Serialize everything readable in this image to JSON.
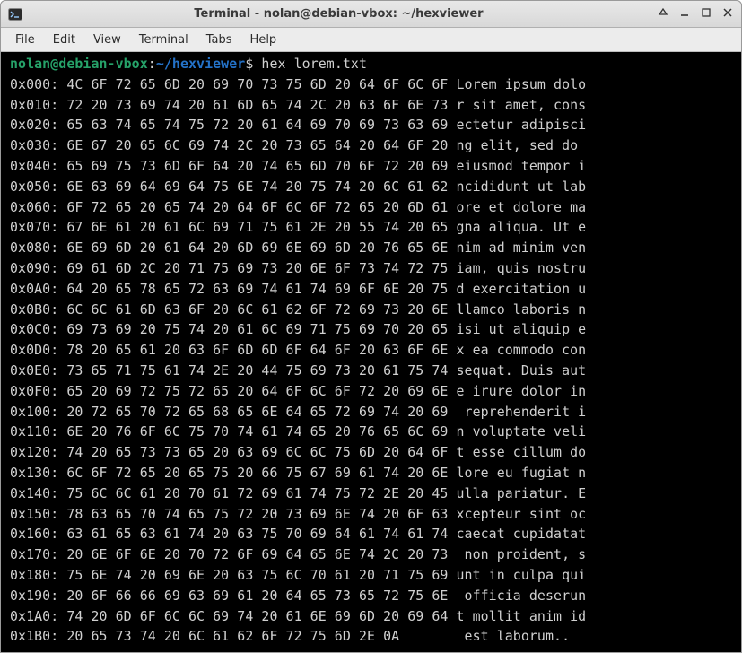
{
  "titlebar": {
    "title": "Terminal - nolan@debian-vbox: ~/hexviewer"
  },
  "menubar": {
    "items": [
      "File",
      "Edit",
      "View",
      "Terminal",
      "Tabs",
      "Help"
    ]
  },
  "prompt": {
    "user": "nolan",
    "at": "@",
    "host": "debian-vbox",
    "colon": ":",
    "path": "~/hexviewer",
    "dollar": "$",
    "command": "hex lorem.txt"
  },
  "hexdump": [
    {
      "offset": "0x000:",
      "ascii": "Lorem ipsum dolo",
      "bytes": " 4C 6F 72 65 6D 20 69 70 73 75 6D 20 64 6F 6C 6F "
    },
    {
      "offset": "0x010:",
      "ascii": "r sit amet, cons",
      "bytes": " 72 20 73 69 74 20 61 6D 65 74 2C 20 63 6F 6E 73 "
    },
    {
      "offset": "0x020:",
      "ascii": "ectetur adipisci",
      "bytes": " 65 63 74 65 74 75 72 20 61 64 69 70 69 73 63 69 "
    },
    {
      "offset": "0x030:",
      "ascii": "ng elit, sed do ",
      "bytes": " 6E 67 20 65 6C 69 74 2C 20 73 65 64 20 64 6F 20 "
    },
    {
      "offset": "0x040:",
      "ascii": "eiusmod tempor i",
      "bytes": " 65 69 75 73 6D 6F 64 20 74 65 6D 70 6F 72 20 69 "
    },
    {
      "offset": "0x050:",
      "ascii": "ncididunt ut lab",
      "bytes": " 6E 63 69 64 69 64 75 6E 74 20 75 74 20 6C 61 62 "
    },
    {
      "offset": "0x060:",
      "ascii": "ore et dolore ma",
      "bytes": " 6F 72 65 20 65 74 20 64 6F 6C 6F 72 65 20 6D 61 "
    },
    {
      "offset": "0x070:",
      "ascii": "gna aliqua. Ut e",
      "bytes": " 67 6E 61 20 61 6C 69 71 75 61 2E 20 55 74 20 65 "
    },
    {
      "offset": "0x080:",
      "ascii": "nim ad minim ven",
      "bytes": " 6E 69 6D 20 61 64 20 6D 69 6E 69 6D 20 76 65 6E "
    },
    {
      "offset": "0x090:",
      "ascii": "iam, quis nostru",
      "bytes": " 69 61 6D 2C 20 71 75 69 73 20 6E 6F 73 74 72 75 "
    },
    {
      "offset": "0x0A0:",
      "ascii": "d exercitation u",
      "bytes": " 64 20 65 78 65 72 63 69 74 61 74 69 6F 6E 20 75 "
    },
    {
      "offset": "0x0B0:",
      "ascii": "llamco laboris n",
      "bytes": " 6C 6C 61 6D 63 6F 20 6C 61 62 6F 72 69 73 20 6E "
    },
    {
      "offset": "0x0C0:",
      "ascii": "isi ut aliquip e",
      "bytes": " 69 73 69 20 75 74 20 61 6C 69 71 75 69 70 20 65 "
    },
    {
      "offset": "0x0D0:",
      "ascii": "x ea commodo con",
      "bytes": " 78 20 65 61 20 63 6F 6D 6D 6F 64 6F 20 63 6F 6E "
    },
    {
      "offset": "0x0E0:",
      "ascii": "sequat. Duis aut",
      "bytes": " 73 65 71 75 61 74 2E 20 44 75 69 73 20 61 75 74 "
    },
    {
      "offset": "0x0F0:",
      "ascii": "e irure dolor in",
      "bytes": " 65 20 69 72 75 72 65 20 64 6F 6C 6F 72 20 69 6E "
    },
    {
      "offset": "0x100:",
      "ascii": " reprehenderit i",
      "bytes": " 20 72 65 70 72 65 68 65 6E 64 65 72 69 74 20 69 "
    },
    {
      "offset": "0x110:",
      "ascii": "n voluptate veli",
      "bytes": " 6E 20 76 6F 6C 75 70 74 61 74 65 20 76 65 6C 69 "
    },
    {
      "offset": "0x120:",
      "ascii": "t esse cillum do",
      "bytes": " 74 20 65 73 73 65 20 63 69 6C 6C 75 6D 20 64 6F "
    },
    {
      "offset": "0x130:",
      "ascii": "lore eu fugiat n",
      "bytes": " 6C 6F 72 65 20 65 75 20 66 75 67 69 61 74 20 6E "
    },
    {
      "offset": "0x140:",
      "ascii": "ulla pariatur. E",
      "bytes": " 75 6C 6C 61 20 70 61 72 69 61 74 75 72 2E 20 45 "
    },
    {
      "offset": "0x150:",
      "ascii": "xcepteur sint oc",
      "bytes": " 78 63 65 70 74 65 75 72 20 73 69 6E 74 20 6F 63 "
    },
    {
      "offset": "0x160:",
      "ascii": "caecat cupidatat",
      "bytes": " 63 61 65 63 61 74 20 63 75 70 69 64 61 74 61 74 "
    },
    {
      "offset": "0x170:",
      "ascii": " non proident, s",
      "bytes": " 20 6E 6F 6E 20 70 72 6F 69 64 65 6E 74 2C 20 73 "
    },
    {
      "offset": "0x180:",
      "ascii": "unt in culpa qui",
      "bytes": " 75 6E 74 20 69 6E 20 63 75 6C 70 61 20 71 75 69 "
    },
    {
      "offset": "0x190:",
      "ascii": " officia deserun",
      "bytes": " 20 6F 66 66 69 63 69 61 20 64 65 73 65 72 75 6E "
    },
    {
      "offset": "0x1A0:",
      "ascii": "t mollit anim id",
      "bytes": " 74 20 6D 6F 6C 6C 69 74 20 61 6E 69 6D 20 69 64 "
    },
    {
      "offset": "0x1B0:",
      "ascii": " est laborum..",
      "bytes": " 20 65 73 74 20 6C 61 62 6F 72 75 6D 2E 0A       "
    }
  ]
}
